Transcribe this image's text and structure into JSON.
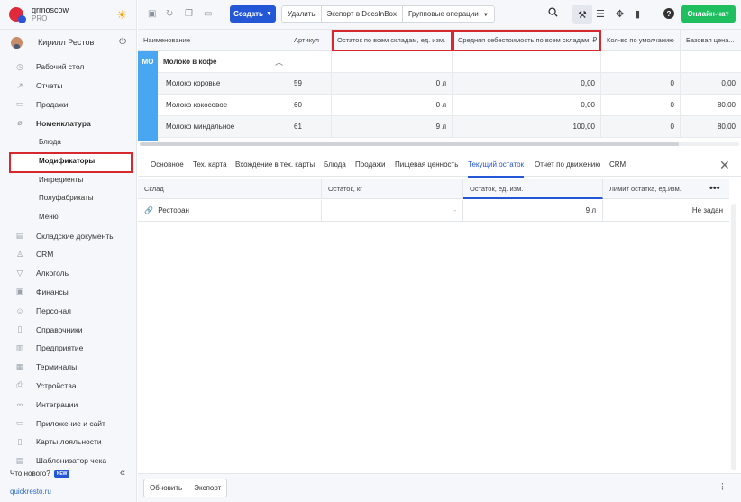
{
  "brand": {
    "name": "qrmoscow",
    "plan": "PRO",
    "theme_icon": "sun-icon"
  },
  "user": {
    "name": "Кирилл Рестов",
    "action_icon": "power-icon"
  },
  "sidebar": {
    "items": [
      {
        "label": "Рабочий стол",
        "icon": "dashboard-icon"
      },
      {
        "label": "Отчеты",
        "icon": "chart-icon"
      },
      {
        "label": "Продажи",
        "icon": "cart-icon"
      },
      {
        "label": "Номенклатура",
        "icon": "tag-icon",
        "expanded": true
      },
      {
        "label": "Блюда",
        "sub": true
      },
      {
        "label": "Модификаторы",
        "sub": true,
        "active": true
      },
      {
        "label": "Ингредиенты",
        "sub": true
      },
      {
        "label": "Полуфабрикаты",
        "sub": true
      },
      {
        "label": "Меню",
        "sub": true
      },
      {
        "label": "Складские документы",
        "icon": "warehouse-icon"
      },
      {
        "label": "CRM",
        "icon": "crm-icon"
      },
      {
        "label": "Алкоголь",
        "icon": "glass-icon"
      },
      {
        "label": "Финансы",
        "icon": "wallet-icon"
      },
      {
        "label": "Персонал",
        "icon": "people-icon"
      },
      {
        "label": "Справочники",
        "icon": "book-icon"
      },
      {
        "label": "Предприятие",
        "icon": "building-icon"
      },
      {
        "label": "Терминалы",
        "icon": "terminal-icon"
      },
      {
        "label": "Устройства",
        "icon": "device-icon"
      },
      {
        "label": "Интеграции",
        "icon": "integration-icon"
      },
      {
        "label": "Приложение и сайт",
        "icon": "app-icon"
      },
      {
        "label": "Карты лояльности",
        "icon": "card-icon"
      },
      {
        "label": "Шаблонизатор чека",
        "icon": "receipt-icon"
      }
    ],
    "whats_new": "Что нового?",
    "new_badge": "NEW",
    "site_link": "quickresto.ru"
  },
  "toolbar": {
    "create_label": "Создать",
    "actions": [
      "Удалить",
      "Экспорт в DocsInBox",
      "Групповые операции"
    ],
    "chat_label": "Онлайн-чат"
  },
  "top_table": {
    "columns": [
      "Наименование",
      "Артикул",
      "Остаток по всем складам, ед. изм.",
      "Средняя себестоимость по всем складам, ₽",
      "Кол-во по умолчанию",
      "Базовая цена..."
    ],
    "highlighted_columns": [
      2,
      3
    ],
    "group": {
      "code": "МО",
      "name": "Молоко в кофе"
    },
    "rows": [
      {
        "name": "Молоко коровье",
        "article": "59",
        "stock": "0 л",
        "avg_cost": "0,00",
        "default_qty": "0",
        "base_price": "0,00"
      },
      {
        "name": "Молоко кокосовое",
        "article": "60",
        "stock": "0 л",
        "avg_cost": "0,00",
        "default_qty": "0",
        "base_price": "80,00"
      },
      {
        "name": "Молоко миндальное",
        "article": "61",
        "stock": "9 л",
        "avg_cost": "100,00",
        "default_qty": "0",
        "base_price": "80,00"
      }
    ]
  },
  "detail": {
    "tabs": [
      "Основное",
      "Тех. карта",
      "Вхождение в тех. карты",
      "Блюда",
      "Продажи",
      "Пищевая ценность",
      "Текущий остаток",
      "Отчет по движению",
      "CRM"
    ],
    "active_tab": "Текущий остаток",
    "columns": [
      "Склад",
      "Остаток, кг",
      "Остаток, ед. изм.",
      "Лимит остатка, ед.изм."
    ],
    "rows": [
      {
        "warehouse": "Ресторан",
        "stock_kg": "-",
        "stock_unit": "9 л",
        "limit": "Не задан"
      }
    ]
  },
  "footer": {
    "refresh_label": "Обновить",
    "export_label": "Экспорт"
  }
}
